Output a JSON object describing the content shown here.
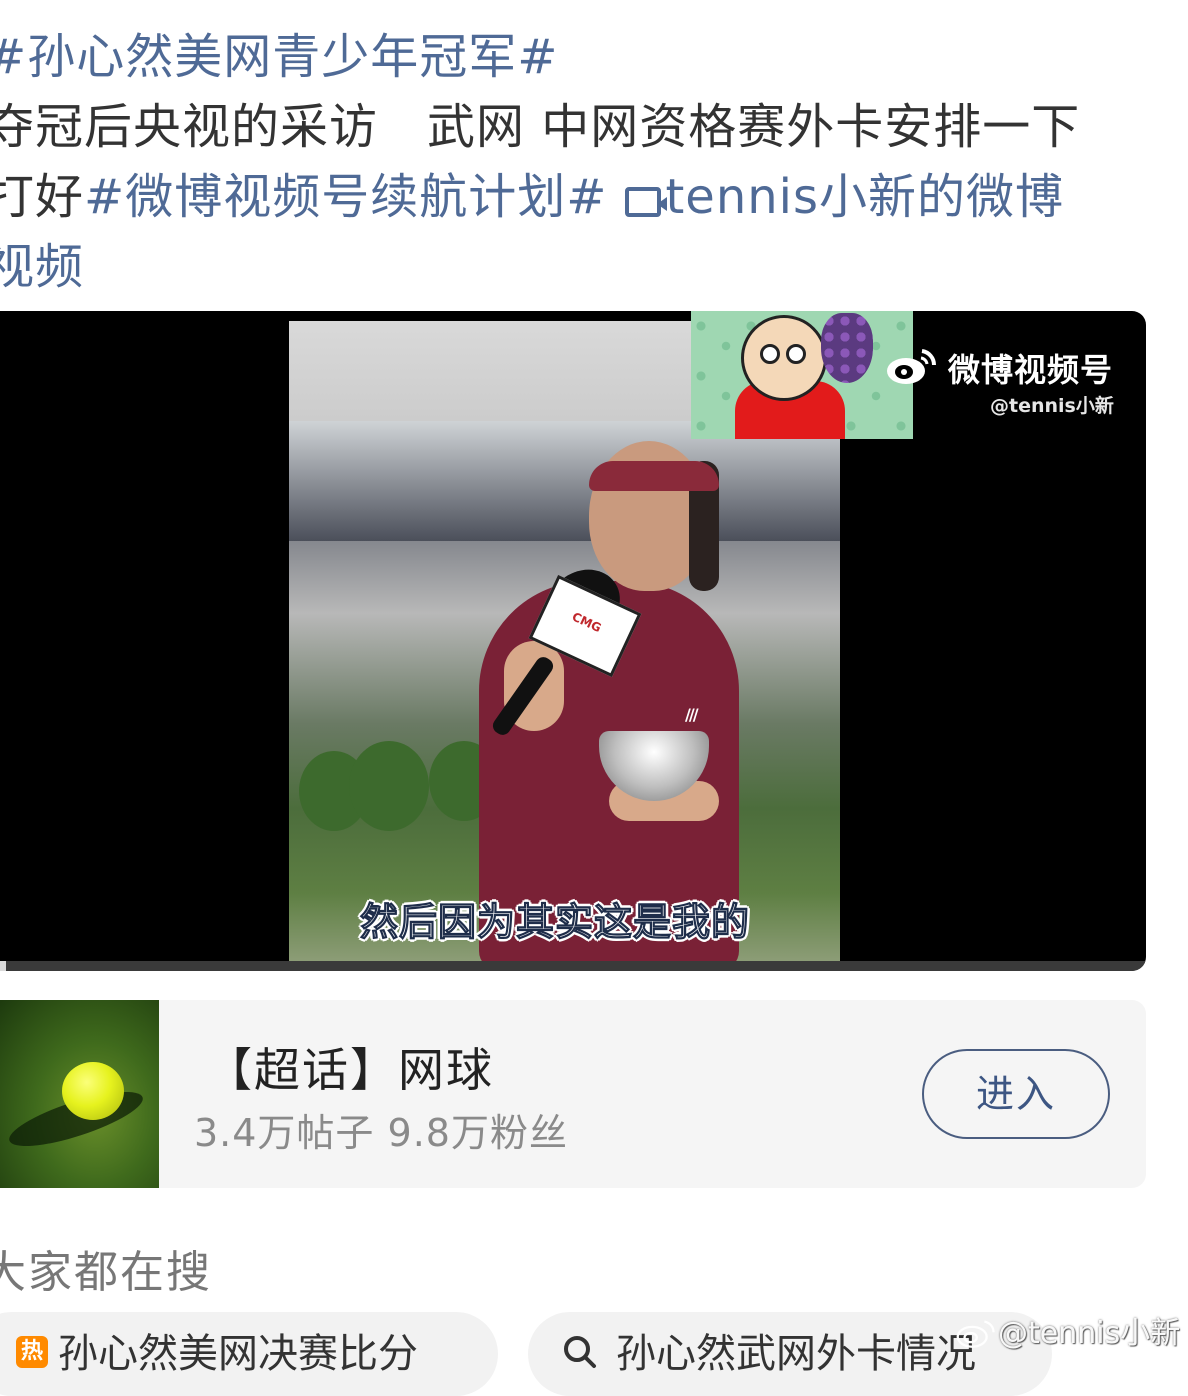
{
  "post": {
    "line1_tag": "#孙心然美网青少年冠军#",
    "line2": "夺冠后央视的采访　武网 中网资格赛外卡安排一下",
    "line3_prefix": "打好",
    "line3_tag": "#微博视频号续航计划#",
    "line3_link": "tennis小新的微博",
    "line4_link": "视频"
  },
  "video": {
    "sticker_alt": "crayon-shin-chan-sticker",
    "watermark_title": "微博视频号",
    "watermark_handle": "@tennis小新",
    "mic_label": "CMG",
    "subtitle": "然后因为其实这是我的",
    "progress": 0.005
  },
  "topic": {
    "name": "【超话】网球",
    "stats": "3.4万帖子 9.8万粉丝",
    "enter_label": "进入"
  },
  "section": {
    "title": "大家都在搜"
  },
  "search_chips": [
    {
      "badge": "热",
      "label": "孙心然美网决赛比分"
    },
    {
      "label": "孙心然武网外卡情况"
    }
  ],
  "corner_watermark": "@tennis小新",
  "colors": {
    "link": "#4f6a96",
    "text": "#333333",
    "hot_badge": "#ff8a00"
  }
}
